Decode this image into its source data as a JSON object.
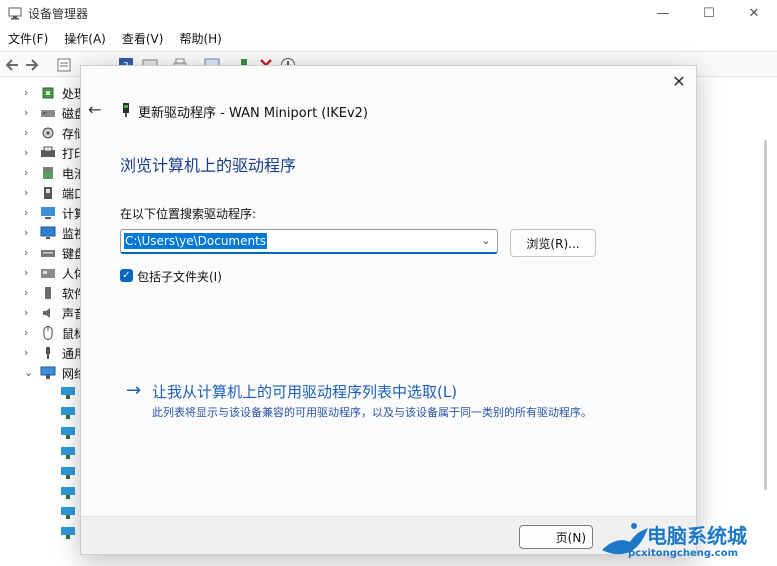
{
  "app": {
    "title": "设备管理器"
  },
  "window_controls": {
    "minimize": "—",
    "maximize": "☐",
    "close": "✕"
  },
  "menubar": [
    {
      "label": "文件(F)"
    },
    {
      "label": "操作(A)"
    },
    {
      "label": "查看(V)"
    },
    {
      "label": "帮助(H)"
    }
  ],
  "tree": {
    "items": [
      {
        "label": "处理",
        "icon": "processor-icon"
      },
      {
        "label": "磁盘",
        "icon": "disk-icon"
      },
      {
        "label": "存储",
        "icon": "storage-icon"
      },
      {
        "label": "打印",
        "icon": "printer-icon"
      },
      {
        "label": "电池",
        "icon": "battery-icon"
      },
      {
        "label": "端口",
        "icon": "port-icon"
      },
      {
        "label": "计算",
        "icon": "computer-icon"
      },
      {
        "label": "监视",
        "icon": "monitor-icon"
      },
      {
        "label": "键盘",
        "icon": "keyboard-icon"
      },
      {
        "label": "人体",
        "icon": "hid-icon"
      },
      {
        "label": "软件",
        "icon": "software-icon"
      },
      {
        "label": "声音",
        "icon": "sound-icon"
      },
      {
        "label": "鼠标",
        "icon": "mouse-icon"
      },
      {
        "label": "通用",
        "icon": "usb-icon"
      },
      {
        "label": "网络",
        "icon": "network-icon"
      }
    ]
  },
  "dialog": {
    "close": "✕",
    "back": "←",
    "header": "更新驱动程序 - WAN Miniport (IKEv2)",
    "heading": "浏览计算机上的驱动程序",
    "search_label": "在以下位置搜索驱动程序:",
    "path_value": "C:\\Users\\ye\\Documents",
    "browse_label": "浏览(R)...",
    "include_subfolders": {
      "label": "包括子文件夹(I)",
      "checked": true
    },
    "pick": {
      "arrow": "→",
      "title": "让我从计算机上的可用驱动程序列表中选取(L)",
      "description": "此列表将显示与该设备兼容的可用驱动程序，以及与该设备属于同一类别的所有驱动程序。"
    },
    "next_label": "页(N)"
  },
  "watermark": {
    "title": "电脑系统城",
    "url": "pcxitongcheng.com"
  },
  "colors": {
    "accent": "#0067c0",
    "selection": "#0078d7",
    "link": "#1b5fb8",
    "heading": "#1a3c8a",
    "watermark": "#1e78c8"
  }
}
